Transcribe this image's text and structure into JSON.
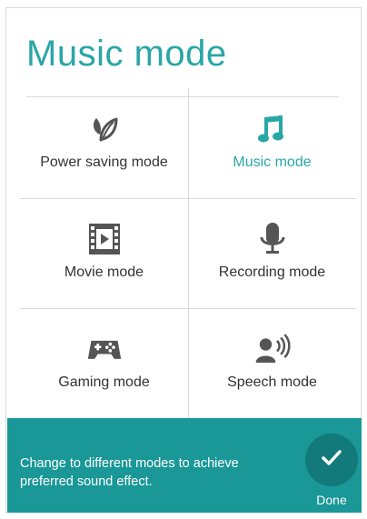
{
  "header": {
    "title": "Music mode"
  },
  "colors": {
    "accent": "#2aa6a6",
    "footer_bg": "#1a9797",
    "done_bg": "#127a7a",
    "text": "#333333"
  },
  "modes": [
    {
      "label": "Power saving mode",
      "icon": "leaf-icon",
      "selected": false
    },
    {
      "label": "Music mode",
      "icon": "music-note-icon",
      "selected": true
    },
    {
      "label": "Movie mode",
      "icon": "film-icon",
      "selected": false
    },
    {
      "label": "Recording mode",
      "icon": "microphone-icon",
      "selected": false
    },
    {
      "label": "Gaming mode",
      "icon": "gamepad-icon",
      "selected": false
    },
    {
      "label": "Speech mode",
      "icon": "speaker-person-icon",
      "selected": false
    }
  ],
  "footer": {
    "message": "Change to different modes to achieve preferred sound effect.",
    "done_label": "Done",
    "done_icon": "checkmark-icon"
  }
}
